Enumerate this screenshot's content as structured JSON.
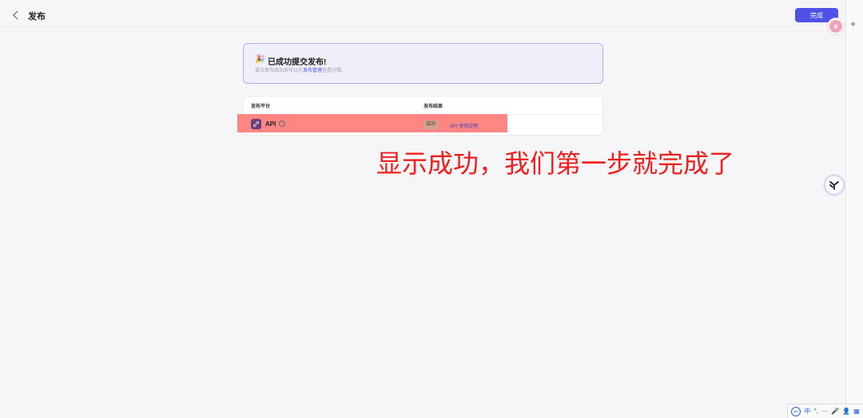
{
  "header": {
    "title": "发布",
    "done_label": "完成"
  },
  "avatar": {
    "initial": "❦"
  },
  "success": {
    "emoji": "🎉",
    "title": "已成功提交发布!",
    "sub_before": "首次发布成功后可以在",
    "sub_link": "发布管理",
    "sub_after": "查看详情。"
  },
  "table": {
    "col_platform": "发布平台",
    "col_result": "发布结果",
    "rows": [
      {
        "platform": "API",
        "status": "成功",
        "doc_link": "API 使用说明"
      }
    ]
  },
  "annotation": {
    "text": "显示成功，我们第一步就完成了"
  },
  "ime": {
    "logo": "abc",
    "lang": "中",
    "items": [
      "°,",
      "⋯",
      "🎤",
      "👤",
      "▦"
    ]
  },
  "colors": {
    "primary": "#4e52e6",
    "highlight": "#ff8682",
    "annotation": "#f01d1d",
    "status_badge": "#d2a28f"
  }
}
